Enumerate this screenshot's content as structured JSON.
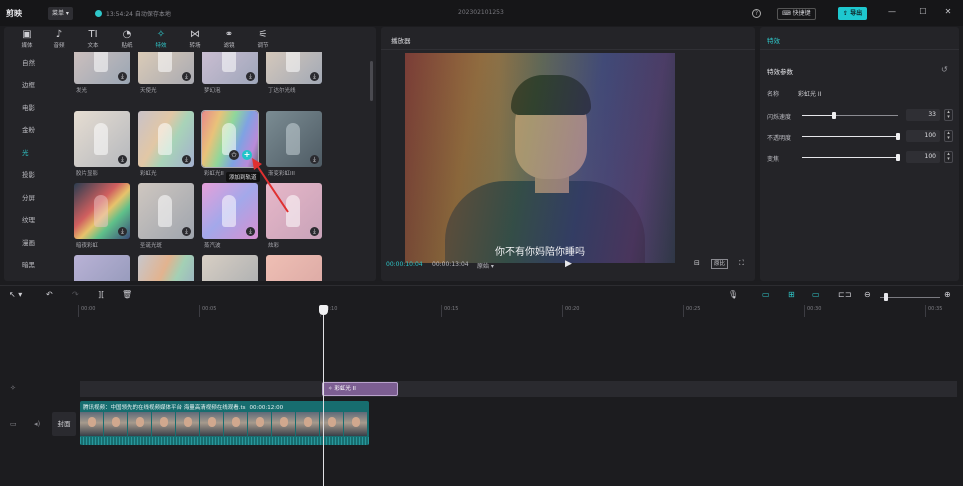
{
  "titlebar": {
    "logo": "剪映",
    "menu": "菜单",
    "save_status": "13:54:24 自动保存本地",
    "project": "202302101253",
    "shortcut": "快捷键",
    "export": "导出"
  },
  "toolbar": [
    {
      "label": "媒体",
      "icon": "▣"
    },
    {
      "label": "音频",
      "icon": "♪"
    },
    {
      "label": "文本",
      "icon": "TI"
    },
    {
      "label": "贴纸",
      "icon": "◔"
    },
    {
      "label": "特效",
      "icon": "✧"
    },
    {
      "label": "转场",
      "icon": "⋈"
    },
    {
      "label": "滤镜",
      "icon": "⚭"
    },
    {
      "label": "调节",
      "icon": "⚟"
    }
  ],
  "categories": [
    "自然",
    "边框",
    "电影",
    "金粉",
    "光",
    "投影",
    "分屏",
    "纹理",
    "漫画",
    "暗黑"
  ],
  "tiles": [
    {
      "label": "发光"
    },
    {
      "label": "天使光"
    },
    {
      "label": "梦幻泡"
    },
    {
      "label": "丁达尔光线"
    },
    {
      "label": "胶片显影"
    },
    {
      "label": "彩虹光"
    },
    {
      "label": "彩虹光II"
    },
    {
      "label": "渐变彩虹III"
    },
    {
      "label": "暗夜彩虹"
    },
    {
      "label": "圣诞光斑"
    },
    {
      "label": "蒸汽波"
    },
    {
      "label": "炫彩"
    },
    {
      "label": ""
    },
    {
      "label": ""
    },
    {
      "label": ""
    },
    {
      "label": ""
    }
  ],
  "tooltip": "添加到轨道",
  "player": {
    "title": "播放器",
    "subtitle": "你不有你妈陪你睡吗",
    "time_current": "00:00:10:04",
    "time_total": "00:00:13:04",
    "ratio": "原始 ▾",
    "ratio_btn": "原比"
  },
  "right": {
    "title": "特效",
    "section": "特效参数",
    "name_label": "名称",
    "name_value": "彩虹光 II",
    "params": [
      {
        "label": "闪烁速度",
        "value": "33",
        "level": 0.33
      },
      {
        "label": "不透明度",
        "value": "100",
        "level": 1.0
      },
      {
        "label": "变焦",
        "value": "100",
        "level": 1.0
      }
    ]
  },
  "ruler": [
    "00:00",
    "00:05",
    "00:10",
    "00:15",
    "00:20",
    "00:25",
    "00:30",
    "00:35"
  ],
  "timeline": {
    "fx_clip": "彩虹光 II",
    "cover": "封面",
    "clip_title": "腾讯视频：中国领先的在线视频媒体平台 海量高清视频在线观看.ts",
    "clip_duration": "00:00:12:00"
  }
}
